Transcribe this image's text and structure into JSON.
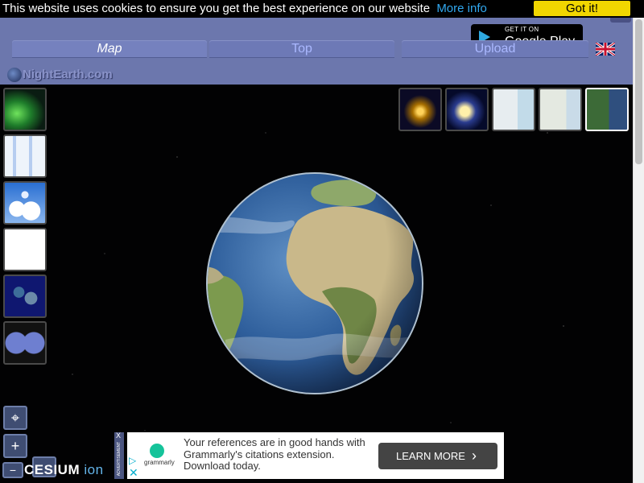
{
  "cookie_bar": {
    "message": "This website uses cookies to ensure you get the best experience on our website",
    "more_link": "More info",
    "accept_button": "Got it!"
  },
  "header": {
    "store_badge": {
      "line1": "GET IT ON",
      "line2": "Google Play"
    },
    "tabs": [
      {
        "label": "Map",
        "active": true
      },
      {
        "label": "Top",
        "active": false
      },
      {
        "label": "Upload",
        "active": false
      }
    ],
    "language_flag": "uk-flag-icon",
    "logo_text": "NightEarth.com"
  },
  "viewer": {
    "left_layers": [
      "aurora",
      "world-map",
      "clouds",
      "blank-map",
      "night-world",
      "twin-globes"
    ],
    "top_layers": [
      "night-lights-1",
      "night-lights-2",
      "street-map-1",
      "street-map-2",
      "satellite"
    ],
    "selected_top_layer": "satellite",
    "nav_buttons": {
      "locate": "⌖",
      "zoom_in": "+",
      "zoom_out": "−"
    },
    "cesium_logo": {
      "main": "CESIUM",
      "suffix": "ion"
    }
  },
  "ad": {
    "label": "ADVERTISEMENT",
    "close": "X",
    "brand": "grammarly",
    "text": "Your references are in good hands with Grammarly's citations extension. Download today.",
    "cta": "LEARN MORE"
  }
}
